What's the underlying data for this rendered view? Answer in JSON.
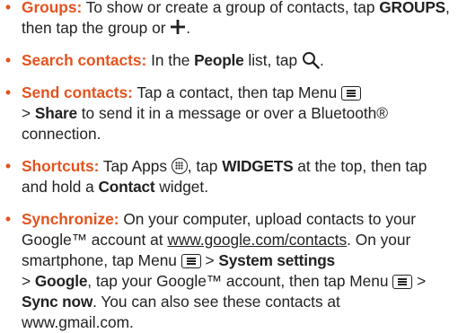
{
  "tips": {
    "groups": {
      "bullet": "•",
      "title": "Groups:",
      "t1": " To show or create a group of contacts, tap ",
      "k1": "GROUPS",
      "t2": ", then tap the group or ",
      "t3": "."
    },
    "search": {
      "bullet": "•",
      "title": "Search contacts:",
      "t1": " In the ",
      "k1": "People",
      "t2": " list, tap ",
      "t3": "."
    },
    "send": {
      "bullet": "•",
      "title": "Send contacts:",
      "t1": " Tap a contact, then tap Menu ",
      "t2": " > ",
      "k1": "Share",
      "t3": " to send it in a message or over a Bluetooth® connection."
    },
    "shortcuts": {
      "bullet": "•",
      "title": "Shortcuts:",
      "t1": " Tap Apps ",
      "t2": ", tap ",
      "k1": "WIDGETS",
      "t3": " at the top, then tap and hold a ",
      "k2": "Contact",
      "t4": " widget."
    },
    "sync": {
      "bullet": "•",
      "title": "Synchronize:",
      "t1": " On your computer, upload contacts to your Google™ account at ",
      "link": "www.google.com/contacts",
      "t2": ". On your smartphone, tap Menu ",
      "t3": " > ",
      "k1": "System settings",
      "t4": " > ",
      "k2": "Google",
      "t5": ", tap your Google™ account, then tap Menu ",
      "t6": " > ",
      "k3": "Sync now",
      "t7": ". You can also see these contacts at www.gmail.com."
    }
  },
  "icons": {
    "plus": "plus-icon",
    "search": "search-icon",
    "menu": "menu-icon",
    "apps": "apps-icon"
  },
  "colors": {
    "accent": "#e4531f",
    "text": "#222222"
  }
}
